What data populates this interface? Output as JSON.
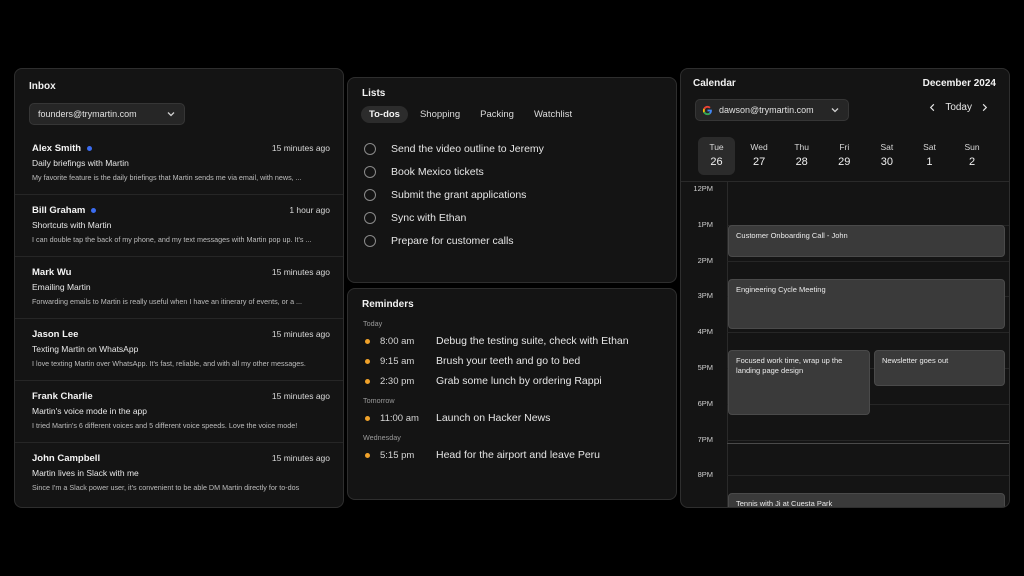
{
  "inbox": {
    "title": "Inbox",
    "account": "founders@trymartin.com",
    "emails": [
      {
        "sender": "Alex Smith",
        "unread": true,
        "time": "15 minutes ago",
        "subject": "Daily briefings with Martin",
        "preview": "My favorite feature is the daily briefings that Martin sends me via email, with news, ..."
      },
      {
        "sender": "Bill Graham",
        "unread": true,
        "time": "1 hour ago",
        "subject": "Shortcuts with Martin",
        "preview": "I can double tap the back of my phone, and my text messages with Martin pop up. It's ..."
      },
      {
        "sender": "Mark Wu",
        "unread": false,
        "time": "15 minutes ago",
        "subject": "Emailing Martin",
        "preview": "Forwarding emails to Martin is really useful when I have an itinerary of events, or a ..."
      },
      {
        "sender": "Jason Lee",
        "unread": false,
        "time": "15 minutes ago",
        "subject": "Texting Martin on WhatsApp",
        "preview": "I love texting Martin over WhatsApp. It's fast, reliable, and with all my other messages."
      },
      {
        "sender": "Frank Charlie",
        "unread": false,
        "time": "15 minutes ago",
        "subject": "Martin's voice mode in the app",
        "preview": "I tried Martin's 6 different voices and 5 different voice speeds. Love the voice mode!"
      },
      {
        "sender": "John Campbell",
        "unread": false,
        "time": "15 minutes ago",
        "subject": "Martin lives in Slack with me",
        "preview": "Since I'm a Slack power user, it's convenient to be able DM Martin directly for to-dos"
      }
    ]
  },
  "lists": {
    "title": "Lists",
    "tabs": [
      {
        "label": "To-dos",
        "active": true
      },
      {
        "label": "Shopping",
        "active": false
      },
      {
        "label": "Packing",
        "active": false
      },
      {
        "label": "Watchlist",
        "active": false
      }
    ],
    "todos": [
      "Send the video outline to Jeremy",
      "Book Mexico tickets",
      "Submit the grant applications",
      "Sync with Ethan",
      "Prepare for customer calls"
    ]
  },
  "reminders": {
    "title": "Reminders",
    "groups": [
      {
        "label": "Today",
        "items": [
          {
            "time": "8:00 am",
            "text": "Debug the testing suite, check with Ethan"
          },
          {
            "time": "9:15 am",
            "text": "Brush your teeth and go to bed"
          },
          {
            "time": "2:30 pm",
            "text": "Grab some lunch by ordering Rappi"
          }
        ]
      },
      {
        "label": "Tomorrow",
        "items": [
          {
            "time": "11:00 am",
            "text": "Launch on Hacker News"
          }
        ]
      },
      {
        "label": "Wednesday",
        "items": [
          {
            "time": "5:15 pm",
            "text": "Head for the airport and leave Peru"
          }
        ]
      }
    ]
  },
  "calendar": {
    "title": "Calendar",
    "month": "December 2024",
    "account": "dawson@trymartin.com",
    "today_label": "Today",
    "days": [
      {
        "name": "Tue",
        "num": "26",
        "active": true
      },
      {
        "name": "Wed",
        "num": "27",
        "active": false
      },
      {
        "name": "Thu",
        "num": "28",
        "active": false
      },
      {
        "name": "Fri",
        "num": "29",
        "active": false
      },
      {
        "name": "Sat",
        "num": "30",
        "active": false
      },
      {
        "name": "Sat",
        "num": "1",
        "active": false
      },
      {
        "name": "Sun",
        "num": "2",
        "active": false
      }
    ],
    "hours": [
      "12PM",
      "1PM",
      "2PM",
      "3PM",
      "4PM",
      "5PM",
      "6PM",
      "7PM",
      "8PM"
    ],
    "events": [
      {
        "title": "Customer Onboarding Call - John",
        "start": 13.0,
        "end": 13.9,
        "column": 0,
        "columns": 1
      },
      {
        "title": "Engineering Cycle Meeting",
        "start": 14.5,
        "end": 15.9,
        "column": 0,
        "columns": 1
      },
      {
        "title": "Focused work time, wrap up the landing page design",
        "start": 16.5,
        "end": 18.3,
        "column": 0,
        "columns": 2
      },
      {
        "title": "Newsletter goes out",
        "start": 16.5,
        "end": 17.5,
        "column": 1,
        "columns": 2
      },
      {
        "title": "Tennis with Ji at Cuesta Park",
        "start": 20.5,
        "end": 21.4,
        "column": 0,
        "columns": 1
      }
    ]
  },
  "icons": {
    "dropdown": "chevron-down-icon",
    "google": "google-icon",
    "prev": "chevron-left-icon",
    "next": "chevron-right-icon"
  },
  "colors": {
    "unread_dot": "#3b6cf0",
    "reminder_dot": "#f0a22a",
    "panel_bg": "#141414",
    "event_bg": "#3a3a3a"
  }
}
